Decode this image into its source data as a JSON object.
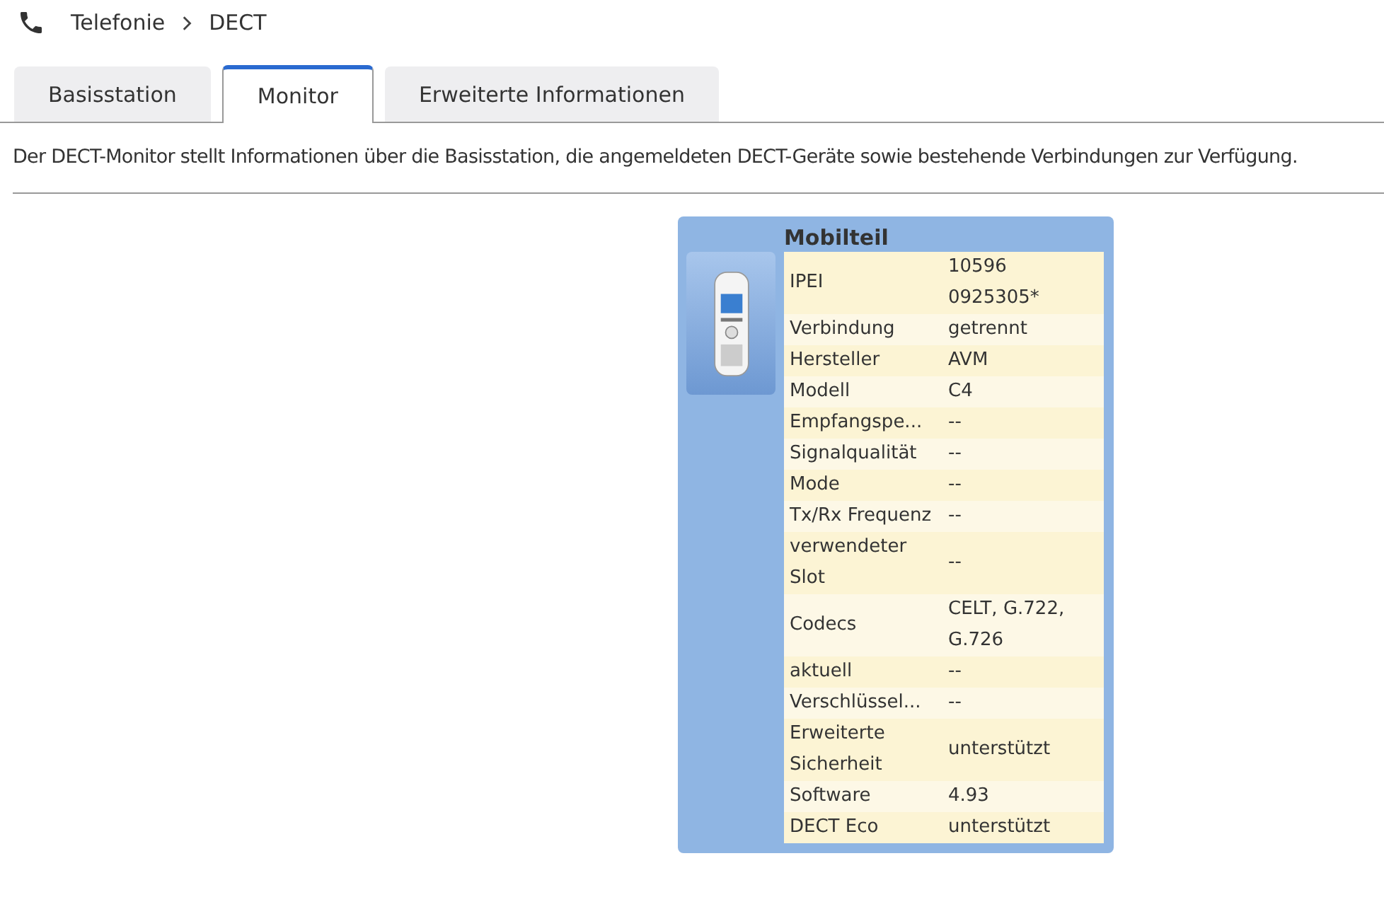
{
  "breadcrumb": [
    "Telefonie",
    "DECT"
  ],
  "tabs": [
    {
      "label": "Basisstation",
      "selected": false
    },
    {
      "label": "Monitor",
      "selected": true
    },
    {
      "label": "Erweiterte Informationen",
      "selected": false
    }
  ],
  "description": "Der DECT-Monitor stellt Informationen über die Basisstation, die angemeldeten DECT-Geräte sowie bestehende Verbindungen zur Verfügung.",
  "panel": {
    "title": "Mobilteil",
    "rows": [
      {
        "label": "IPEI",
        "value": "10596 0925305*"
      },
      {
        "label": "Verbindung",
        "value": "getrennt"
      },
      {
        "label": "Hersteller",
        "value": "AVM"
      },
      {
        "label": "Modell",
        "value": "C4"
      },
      {
        "label": "Empfangspe...",
        "value": "--"
      },
      {
        "label": "Signalqualität",
        "value": "--"
      },
      {
        "label": "Mode",
        "value": "--"
      },
      {
        "label": "Tx/Rx Frequenz",
        "value": "--"
      },
      {
        "label": "verwendeter Slot",
        "value": "--"
      },
      {
        "label": "Codecs",
        "value": "CELT, G.722, G.726"
      },
      {
        "label": "aktuell",
        "value": "--"
      },
      {
        "label": "Verschlüssel...",
        "value": "--"
      },
      {
        "label": "Erweiterte Sicherheit",
        "value": "unterstützt"
      },
      {
        "label": "Software",
        "value": "4.93"
      },
      {
        "label": "DECT Eco",
        "value": "unterstützt"
      }
    ]
  }
}
